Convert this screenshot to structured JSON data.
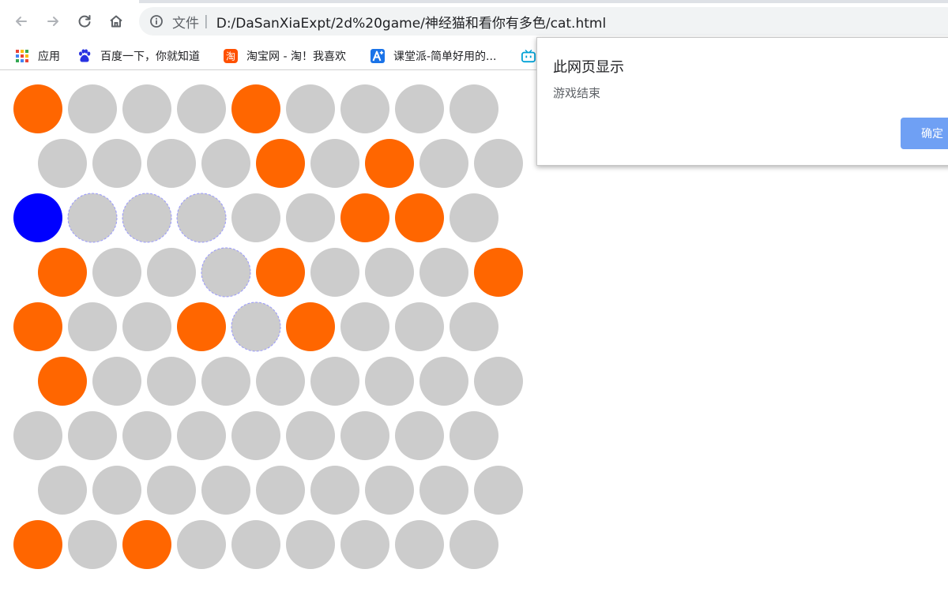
{
  "browser": {
    "address": {
      "scheme_label": "文件",
      "separator": "|",
      "url": "D:/DaSanXiaExpt/2d%20game/神经猫和看你有多色/cat.html"
    },
    "bookmarks": [
      {
        "label": "应用",
        "icon": "apps-grid-icon"
      },
      {
        "label": "百度一下，你就知道",
        "icon": "baidu-paw-icon"
      },
      {
        "label": "淘宝网 - 淘！我喜欢",
        "icon": "taobao-icon"
      },
      {
        "label": "课堂派-简单好用的...",
        "icon": "ketangpai-icon"
      },
      {
        "label": "",
        "icon": "bilibili-tv-icon"
      }
    ]
  },
  "dialog": {
    "title": "此网页显示",
    "message": "游戏结束",
    "ok_label": "确定"
  },
  "game": {
    "colors": {
      "empty": "#cccccc",
      "wall": "#ff6600",
      "cat": "#0000ff",
      "path_border": "#9999ff"
    },
    "legend_note": "cell codes: 0 = empty (grey), 1 = wall (orange), 2 = cat (blue), 3 = empty cell with dashed outline",
    "rows": [
      [
        1,
        0,
        0,
        0,
        1,
        0,
        0,
        0,
        0
      ],
      [
        0,
        0,
        0,
        0,
        1,
        0,
        1,
        0,
        0
      ],
      [
        2,
        3,
        3,
        3,
        0,
        0,
        1,
        1,
        0
      ],
      [
        1,
        0,
        0,
        3,
        1,
        0,
        0,
        0,
        1
      ],
      [
        1,
        0,
        0,
        1,
        3,
        1,
        0,
        0,
        0
      ],
      [
        1,
        0,
        0,
        0,
        0,
        0,
        0,
        0,
        0
      ],
      [
        0,
        0,
        0,
        0,
        0,
        0,
        0,
        0,
        0
      ],
      [
        0,
        0,
        0,
        0,
        0,
        0,
        0,
        0,
        0
      ],
      [
        1,
        0,
        1,
        0,
        0,
        0,
        0,
        0,
        0
      ]
    ]
  }
}
